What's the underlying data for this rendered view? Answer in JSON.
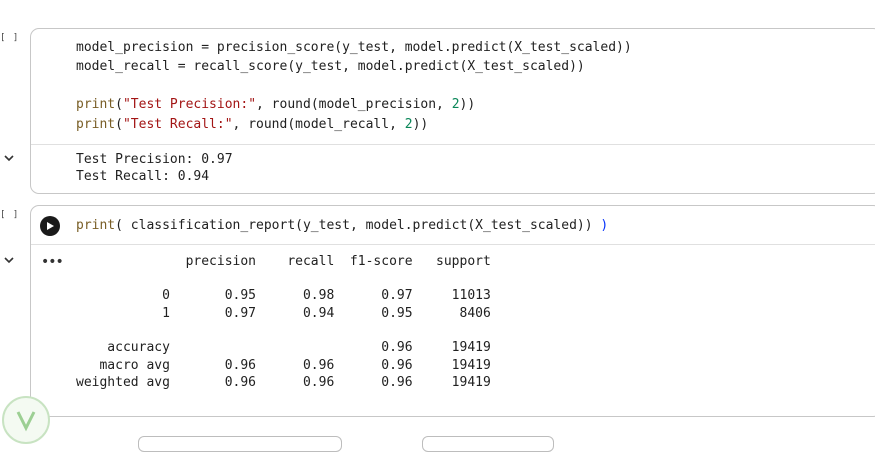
{
  "cell1": {
    "gutter_label": "[ ]",
    "code": [
      "model_precision = precision_score(y_test, model.predict(X_test_scaled))",
      "model_recall = recall_score(y_test, model.predict(X_test_scaled))",
      "",
      "print(\"Test Precision:\", round(model_precision, 2))",
      "print(\"Test Recall:\", round(model_recall, 2))"
    ],
    "output": [
      "Test Precision: 0.97",
      "Test Recall: 0.94"
    ]
  },
  "cell2": {
    "gutter_label": "[ ]",
    "code": "print( classification_report(y_test, model.predict(X_test_scaled)) )",
    "output_header": "              precision    recall  f1-score   support",
    "output_rows": [
      "           0       0.95      0.98      0.97     11013",
      "           1       0.97      0.94      0.95      8406",
      "",
      "    accuracy                           0.96     19419",
      "   macro avg       0.96      0.96      0.96     19419",
      "weighted avg       0.96      0.96      0.96     19419"
    ]
  },
  "colors": {
    "print": "#795e26",
    "string": "#a31515",
    "number": "#098658",
    "cell_border": "#c7c7c7"
  }
}
